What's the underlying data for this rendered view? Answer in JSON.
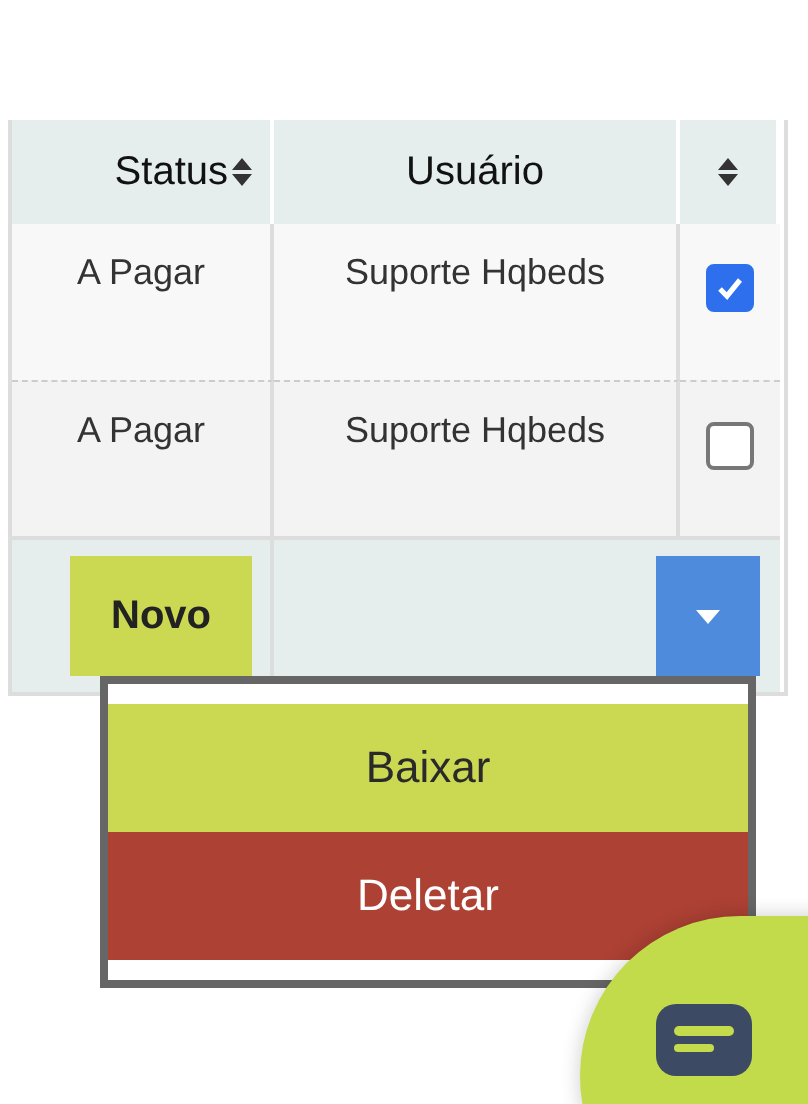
{
  "table": {
    "columns": [
      {
        "label": "Status",
        "sortable": true
      },
      {
        "label": "Usuário",
        "sortable": false
      },
      {
        "sortable": true
      }
    ],
    "rows": [
      {
        "status": "A Pagar",
        "user": "Suporte Hqbeds",
        "checked": true
      },
      {
        "status": "A Pagar",
        "user": "Suporte Hqbeds",
        "checked": false
      }
    ]
  },
  "footer": {
    "new_button": "Novo"
  },
  "menu": {
    "expanded": true,
    "items": [
      {
        "label": "Baixar",
        "kind": "download"
      },
      {
        "label": "Deletar",
        "kind": "delete"
      }
    ]
  }
}
